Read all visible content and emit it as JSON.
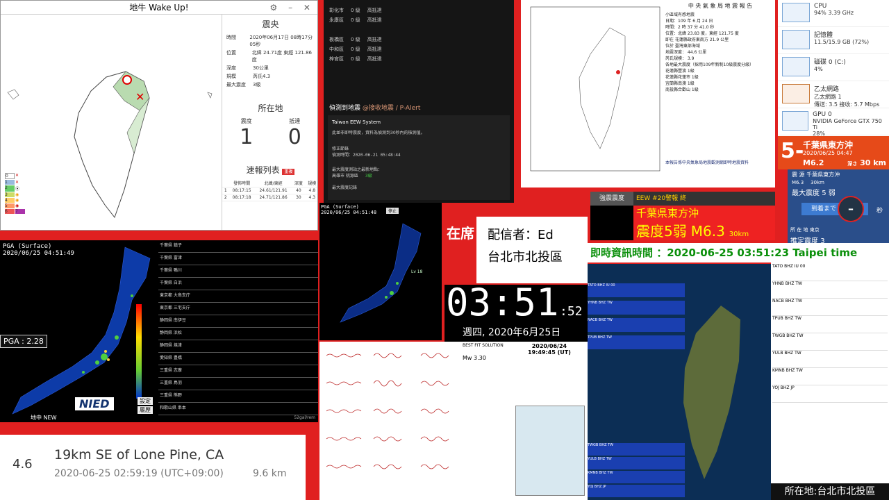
{
  "app": {
    "title": "地牛 Wake Up!",
    "controls": "⚙ – ✕"
  },
  "epicenter": {
    "header": "震央",
    "rows": [
      {
        "k": "時間",
        "v": "2020年06月17日 08時17分05秒"
      },
      {
        "k": "位置",
        "v": "北緯 24.71度 東經 121.86度"
      },
      {
        "k": "深度",
        "v": "30公里"
      },
      {
        "k": "規模",
        "v": "芮氏4.3"
      },
      {
        "k": "最大震度",
        "v": "3級"
      }
    ]
  },
  "location": {
    "header": "所在地",
    "intensity_label": "震度",
    "intensity": "1",
    "arrive_label": "抵達",
    "arrive": "0"
  },
  "reports": {
    "header": "速報列表",
    "badge": "重複",
    "cols": [
      "",
      "發佈時間",
      "北緯/東經",
      "深度",
      "規模"
    ],
    "rows": [
      [
        "1",
        "08:17:15",
        "24.61/121.91",
        "40",
        "4.8"
      ],
      [
        "2",
        "08:17:18",
        "24.71/121.86",
        "30",
        "4.3"
      ]
    ]
  },
  "legend": [
    "0",
    "1",
    "2",
    "3",
    "4",
    "5",
    "6",
    "7"
  ],
  "chat": {
    "districts": [
      {
        "n": "彰化市",
        "v": "0 級",
        "s": "高抵達"
      },
      {
        "n": "永康區",
        "v": "0 級",
        "s": "高抵達"
      },
      {
        "n": "板橋區",
        "v": "0 級",
        "s": "高抵達"
      },
      {
        "n": "中和區",
        "v": "0 級",
        "s": "高抵達"
      },
      {
        "n": "梓官區",
        "v": "0 級",
        "s": "高抵達"
      }
    ],
    "detect": "偵測到地震",
    "alert": "@接收地震 / P-Alert",
    "eew_title": "Taiwan EEW System",
    "eew_text": "此並非即時震度，資料為偵測到30秒內的檢測值。",
    "fix": "修正節錄",
    "detect_time": "偵測時間：2020-06-21 05:48:44",
    "max_label": "最大震度測站之最新地點：",
    "max_loc": "高雄市 桃源區",
    "max_val": "3級",
    "rec": "最大震度記錄"
  },
  "cwb": {
    "title": "中 央 氣 象 局 地 震 報 告",
    "lines": [
      "小區域有感地震",
      "日期：109 年 6 月 24 日",
      "時間：2 時 37 分 41.0 秒",
      "位置：北緯 23.83 度，東經 121.75 度",
      "即在 花蓮縣政府東南方 21.9 公里",
      "位於 臺灣東部海域",
      "地震深度： 44.6 公里",
      "芮氏規模： 3.9",
      "各地最大震度（採用109年新制10級震度分級）",
      "花蓮縣豐濱 1級",
      "花蓮縣花蓮市 1級",
      "宜蘭縣南澳 1級",
      "南投縣合歡山 1級"
    ],
    "footer": "本報告係中央氣象局地震觀測網即時地震資料"
  },
  "tm": [
    {
      "name": "CPU",
      "val": "94% 3.39 GHz"
    },
    {
      "name": "記憶體",
      "val": "11.5/15.9 GB (72%)"
    },
    {
      "name": "磁碟 0 (C:)",
      "val": "4%"
    },
    {
      "name": "乙太網路",
      "val": "乙太網路 1",
      "sub": "傳送: 3.5 接收: 5.7 Mbps"
    },
    {
      "name": "GPU 0",
      "val": "NVIDIA GeForce GTX 750 Ti",
      "sub": "28%"
    }
  ],
  "jp": {
    "int": "5-",
    "place": "千葉県東方沖",
    "time": "2020/06/25 04:47",
    "mag": "M6.2",
    "depth_label": "深さ",
    "depth": "30 km"
  },
  "jpbox": {
    "head": "震 源",
    "place": "千葉県東方沖",
    "mag": "M6.3",
    "depth": "30km",
    "maxlabel": "最大震度",
    "maxval": "5 弱",
    "arr": "到着まで",
    "sec": "秒",
    "here": "所 在 地",
    "city": "東京",
    "est": "推定震度",
    "estval": "3"
  },
  "nied": {
    "title": "PGA (Surface)",
    "time": "2020/06/25 04:51:49",
    "pga": "PGA : 2.28",
    "regions": [
      "千葉県 鎮子",
      "千葉県 富津",
      "千葉県 鴨川",
      "千葉県 白浜",
      "東京都 大島支庁",
      "東京都 三宅支庁",
      "静岡県 南伊豆",
      "静岡県 浜松",
      "静岡県 焼津",
      "愛知県 豊橋",
      "三重県 志摩",
      "三重県 鳥羽",
      "三重県 熊野",
      "和歌山県 串本"
    ],
    "name": "NIED",
    "btns": [
      "設定",
      "履歴"
    ],
    "bottom": "地中 NEW",
    "scale": "52gal/rem"
  },
  "nied2": {
    "title": "PGA (Surface)",
    "time": "2020/06/25 04:51:48",
    "btn": "停止",
    "stat": "Lv 18"
  },
  "streamer": {
    "tag": "在席",
    "line1": "配信者：Ed",
    "line2": "台北市北投區"
  },
  "clock": {
    "hm": "03:51",
    "s": ":52",
    "date": "週四, 2020年6月25日"
  },
  "eew": {
    "label": "強震震度",
    "tag": "EEW #20警報 終",
    "place": "千葉県東方沖",
    "int": "震度5弱",
    "mag": "M6.3",
    "depth": "30km"
  },
  "realtime": "即時資訊時間 ：2020-06-25 03:51:23 Taipei time",
  "spectro": [
    "TATO BHZ IU 00",
    "YHNB BHZ TW",
    "NACB BHZ TW",
    "TPUB BHZ TW",
    "TWGB BHZ TW",
    "YULB BHZ TW",
    "KMNB BHZ TW",
    "YOJ BHZ JP"
  ],
  "seis": [
    "TATO BHZ IU 00",
    "YHNB BHZ TW",
    "NACB BHZ TW",
    "TPUB BHZ TW",
    "TWGB BHZ TW",
    "YULB BHZ TW",
    "KMNB BHZ TW",
    "YOJ BHZ JP"
  ],
  "where": "所在地:台北市北投區",
  "bestfit": {
    "title": "BEST FIT SOLUTION",
    "date": "2020/06/24",
    "utc": "19:49:45 (UT)",
    "mw": "3.30"
  },
  "usgs": {
    "mag": "4.6",
    "place": "19km SE of Lone Pine, CA",
    "time": "2020-06-25 02:59:19 (UTC+09:00)",
    "depth": "9.6 km"
  }
}
